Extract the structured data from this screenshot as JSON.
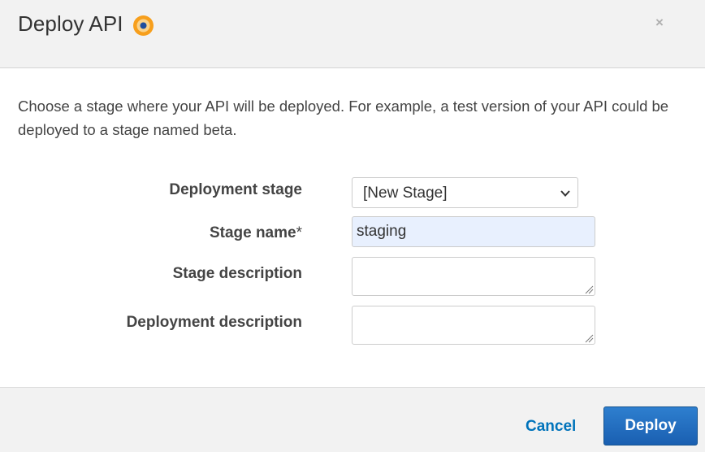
{
  "dialog": {
    "title": "Deploy API",
    "info_icon": "info-circle-icon",
    "close_label": "×",
    "description": "Choose a stage where your API will be deployed. For example, a test version of your API could be deployed to a stage named beta."
  },
  "form": {
    "deployment_stage": {
      "label": "Deployment stage",
      "value": "[New Stage]"
    },
    "stage_name": {
      "label": "Stage name",
      "required_mark": "*",
      "value": "staging"
    },
    "stage_description": {
      "label": "Stage description",
      "value": ""
    },
    "deployment_description": {
      "label": "Deployment description",
      "value": ""
    }
  },
  "footer": {
    "cancel_label": "Cancel",
    "deploy_label": "Deploy"
  },
  "colors": {
    "header_bg": "#f2f2f2",
    "info_icon_ring": "#f79f1c",
    "info_icon_dot": "#1f4e9e",
    "link": "#0073bb",
    "primary_button": "#1a63b5",
    "autofill_bg": "#e8f0fe"
  }
}
